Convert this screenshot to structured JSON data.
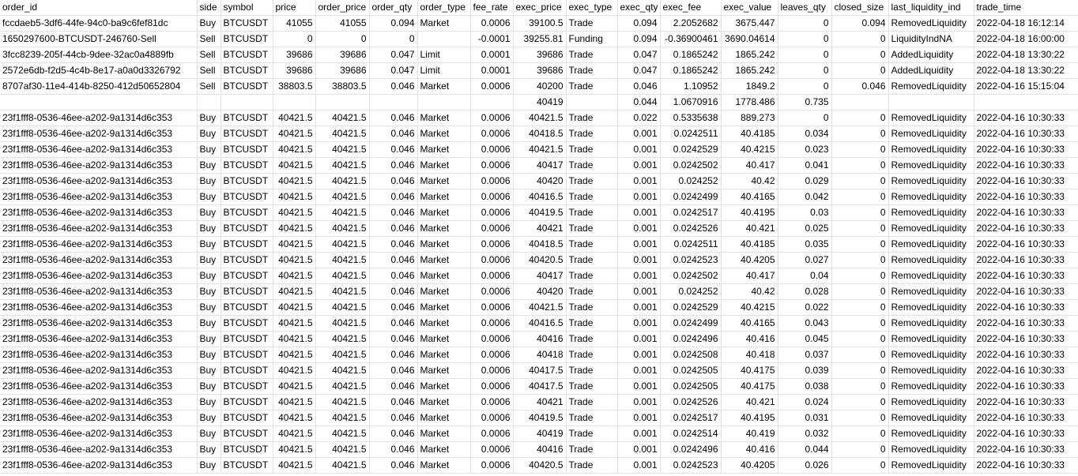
{
  "columns": [
    {
      "label": "order_id",
      "align": "left"
    },
    {
      "label": "side",
      "align": "left"
    },
    {
      "label": "symbol",
      "align": "left"
    },
    {
      "label": "price",
      "align": "right"
    },
    {
      "label": "order_price",
      "align": "right"
    },
    {
      "label": "order_qty",
      "align": "right"
    },
    {
      "label": "order_type",
      "align": "left"
    },
    {
      "label": "fee_rate",
      "align": "right"
    },
    {
      "label": "exec_price",
      "align": "right"
    },
    {
      "label": "exec_type",
      "align": "left"
    },
    {
      "label": "exec_qty",
      "align": "right"
    },
    {
      "label": "exec_fee",
      "align": "right"
    },
    {
      "label": "exec_value",
      "align": "right"
    },
    {
      "label": "leaves_qty",
      "align": "right"
    },
    {
      "label": "closed_size",
      "align": "right"
    },
    {
      "label": "last_liquidity_ind",
      "align": "left"
    },
    {
      "label": "trade_time",
      "align": "left"
    }
  ],
  "rows": [
    [
      "fccdaeb5-3df6-44fe-94c0-ba9c6fef81dc",
      "Buy",
      "BTCUSDT",
      "41055",
      "41055",
      "0.094",
      "Market",
      "0.0006",
      "39100.5",
      "Trade",
      "0.094",
      "2.2052682",
      "3675.447",
      "0",
      "0.094",
      "RemovedLiquidity",
      "2022-04-18 16:12:14"
    ],
    [
      "1650297600-BTCUSDT-246760-Sell",
      "Sell",
      "BTCUSDT",
      "0",
      "0",
      "0",
      "",
      "-0.0001",
      "39255.81",
      "Funding",
      "0.094",
      "-0.36900461",
      "3690.04614",
      "0",
      "0",
      "LiquidityIndNA",
      "2022-04-18 16:00:00"
    ],
    [
      "3fcc8239-205f-44cb-9dee-32ac0a4889fb",
      "Sell",
      "BTCUSDT",
      "39686",
      "39686",
      "0.047",
      "Limit",
      "0.0001",
      "39686",
      "Trade",
      "0.047",
      "0.1865242",
      "1865.242",
      "0",
      "0",
      "AddedLiquidity",
      "2022-04-18 13:30:22"
    ],
    [
      "2572e6db-f2d5-4c4b-8e17-a0a0d3326792",
      "Sell",
      "BTCUSDT",
      "39686",
      "39686",
      "0.047",
      "Limit",
      "0.0001",
      "39686",
      "Trade",
      "0.047",
      "0.1865242",
      "1865.242",
      "0",
      "0",
      "AddedLiquidity",
      "2022-04-18 13:30:22"
    ],
    [
      "8707af30-11e4-414b-8250-412d50652804",
      "Sell",
      "BTCUSDT",
      "38803.5",
      "38803.5",
      "0.046",
      "Market",
      "0.0006",
      "40200",
      "Trade",
      "0.046",
      "1.10952",
      "1849.2",
      "0",
      "0.046",
      "RemovedLiquidity",
      "2022-04-16 15:15:04"
    ],
    [
      "",
      "",
      "",
      "",
      "",
      "",
      "",
      "",
      "40419",
      "",
      "0.044",
      "1.0670916",
      "1778.486",
      "0.735",
      "",
      "",
      ""
    ],
    [
      "23f1fff8-0536-46ee-a202-9a1314d6c353",
      "Buy",
      "BTCUSDT",
      "40421.5",
      "40421.5",
      "0.046",
      "Market",
      "0.0006",
      "40421.5",
      "Trade",
      "0.022",
      "0.5335638",
      "889.273",
      "0",
      "0",
      "RemovedLiquidity",
      "2022-04-16 10:30:33"
    ],
    [
      "23f1fff8-0536-46ee-a202-9a1314d6c353",
      "Buy",
      "BTCUSDT",
      "40421.5",
      "40421.5",
      "0.046",
      "Market",
      "0.0006",
      "40418.5",
      "Trade",
      "0.001",
      "0.0242511",
      "40.4185",
      "0.034",
      "0",
      "RemovedLiquidity",
      "2022-04-16 10:30:33"
    ],
    [
      "23f1fff8-0536-46ee-a202-9a1314d6c353",
      "Buy",
      "BTCUSDT",
      "40421.5",
      "40421.5",
      "0.046",
      "Market",
      "0.0006",
      "40421.5",
      "Trade",
      "0.001",
      "0.0242529",
      "40.4215",
      "0.023",
      "0",
      "RemovedLiquidity",
      "2022-04-16 10:30:33"
    ],
    [
      "23f1fff8-0536-46ee-a202-9a1314d6c353",
      "Buy",
      "BTCUSDT",
      "40421.5",
      "40421.5",
      "0.046",
      "Market",
      "0.0006",
      "40417",
      "Trade",
      "0.001",
      "0.0242502",
      "40.417",
      "0.041",
      "0",
      "RemovedLiquidity",
      "2022-04-16 10:30:33"
    ],
    [
      "23f1fff8-0536-46ee-a202-9a1314d6c353",
      "Buy",
      "BTCUSDT",
      "40421.5",
      "40421.5",
      "0.046",
      "Market",
      "0.0006",
      "40420",
      "Trade",
      "0.001",
      "0.024252",
      "40.42",
      "0.029",
      "0",
      "RemovedLiquidity",
      "2022-04-16 10:30:33"
    ],
    [
      "23f1fff8-0536-46ee-a202-9a1314d6c353",
      "Buy",
      "BTCUSDT",
      "40421.5",
      "40421.5",
      "0.046",
      "Market",
      "0.0006",
      "40416.5",
      "Trade",
      "0.001",
      "0.0242499",
      "40.4165",
      "0.042",
      "0",
      "RemovedLiquidity",
      "2022-04-16 10:30:33"
    ],
    [
      "23f1fff8-0536-46ee-a202-9a1314d6c353",
      "Buy",
      "BTCUSDT",
      "40421.5",
      "40421.5",
      "0.046",
      "Market",
      "0.0006",
      "40419.5",
      "Trade",
      "0.001",
      "0.0242517",
      "40.4195",
      "0.03",
      "0",
      "RemovedLiquidity",
      "2022-04-16 10:30:33"
    ],
    [
      "23f1fff8-0536-46ee-a202-9a1314d6c353",
      "Buy",
      "BTCUSDT",
      "40421.5",
      "40421.5",
      "0.046",
      "Market",
      "0.0006",
      "40421",
      "Trade",
      "0.001",
      "0.0242526",
      "40.421",
      "0.025",
      "0",
      "RemovedLiquidity",
      "2022-04-16 10:30:33"
    ],
    [
      "23f1fff8-0536-46ee-a202-9a1314d6c353",
      "Buy",
      "BTCUSDT",
      "40421.5",
      "40421.5",
      "0.046",
      "Market",
      "0.0006",
      "40418.5",
      "Trade",
      "0.001",
      "0.0242511",
      "40.4185",
      "0.035",
      "0",
      "RemovedLiquidity",
      "2022-04-16 10:30:33"
    ],
    [
      "23f1fff8-0536-46ee-a202-9a1314d6c353",
      "Buy",
      "BTCUSDT",
      "40421.5",
      "40421.5",
      "0.046",
      "Market",
      "0.0006",
      "40420.5",
      "Trade",
      "0.001",
      "0.0242523",
      "40.4205",
      "0.027",
      "0",
      "RemovedLiquidity",
      "2022-04-16 10:30:33"
    ],
    [
      "23f1fff8-0536-46ee-a202-9a1314d6c353",
      "Buy",
      "BTCUSDT",
      "40421.5",
      "40421.5",
      "0.046",
      "Market",
      "0.0006",
      "40417",
      "Trade",
      "0.001",
      "0.0242502",
      "40.417",
      "0.04",
      "0",
      "RemovedLiquidity",
      "2022-04-16 10:30:33"
    ],
    [
      "23f1fff8-0536-46ee-a202-9a1314d6c353",
      "Buy",
      "BTCUSDT",
      "40421.5",
      "40421.5",
      "0.046",
      "Market",
      "0.0006",
      "40420",
      "Trade",
      "0.001",
      "0.024252",
      "40.42",
      "0.028",
      "0",
      "RemovedLiquidity",
      "2022-04-16 10:30:33"
    ],
    [
      "23f1fff8-0536-46ee-a202-9a1314d6c353",
      "Buy",
      "BTCUSDT",
      "40421.5",
      "40421.5",
      "0.046",
      "Market",
      "0.0006",
      "40421.5",
      "Trade",
      "0.001",
      "0.0242529",
      "40.4215",
      "0.022",
      "0",
      "RemovedLiquidity",
      "2022-04-16 10:30:33"
    ],
    [
      "23f1fff8-0536-46ee-a202-9a1314d6c353",
      "Buy",
      "BTCUSDT",
      "40421.5",
      "40421.5",
      "0.046",
      "Market",
      "0.0006",
      "40416.5",
      "Trade",
      "0.001",
      "0.0242499",
      "40.4165",
      "0.043",
      "0",
      "RemovedLiquidity",
      "2022-04-16 10:30:33"
    ],
    [
      "23f1fff8-0536-46ee-a202-9a1314d6c353",
      "Buy",
      "BTCUSDT",
      "40421.5",
      "40421.5",
      "0.046",
      "Market",
      "0.0006",
      "40416",
      "Trade",
      "0.001",
      "0.0242496",
      "40.416",
      "0.045",
      "0",
      "RemovedLiquidity",
      "2022-04-16 10:30:33"
    ],
    [
      "23f1fff8-0536-46ee-a202-9a1314d6c353",
      "Buy",
      "BTCUSDT",
      "40421.5",
      "40421.5",
      "0.046",
      "Market",
      "0.0006",
      "40418",
      "Trade",
      "0.001",
      "0.0242508",
      "40.418",
      "0.037",
      "0",
      "RemovedLiquidity",
      "2022-04-16 10:30:33"
    ],
    [
      "23f1fff8-0536-46ee-a202-9a1314d6c353",
      "Buy",
      "BTCUSDT",
      "40421.5",
      "40421.5",
      "0.046",
      "Market",
      "0.0006",
      "40417.5",
      "Trade",
      "0.001",
      "0.0242505",
      "40.4175",
      "0.039",
      "0",
      "RemovedLiquidity",
      "2022-04-16 10:30:33"
    ],
    [
      "23f1fff8-0536-46ee-a202-9a1314d6c353",
      "Buy",
      "BTCUSDT",
      "40421.5",
      "40421.5",
      "0.046",
      "Market",
      "0.0006",
      "40417.5",
      "Trade",
      "0.001",
      "0.0242505",
      "40.4175",
      "0.038",
      "0",
      "RemovedLiquidity",
      "2022-04-16 10:30:33"
    ],
    [
      "23f1fff8-0536-46ee-a202-9a1314d6c353",
      "Buy",
      "BTCUSDT",
      "40421.5",
      "40421.5",
      "0.046",
      "Market",
      "0.0006",
      "40421",
      "Trade",
      "0.001",
      "0.0242526",
      "40.421",
      "0.024",
      "0",
      "RemovedLiquidity",
      "2022-04-16 10:30:33"
    ],
    [
      "23f1fff8-0536-46ee-a202-9a1314d6c353",
      "Buy",
      "BTCUSDT",
      "40421.5",
      "40421.5",
      "0.046",
      "Market",
      "0.0006",
      "40419.5",
      "Trade",
      "0.001",
      "0.0242517",
      "40.4195",
      "0.031",
      "0",
      "RemovedLiquidity",
      "2022-04-16 10:30:33"
    ],
    [
      "23f1fff8-0536-46ee-a202-9a1314d6c353",
      "Buy",
      "BTCUSDT",
      "40421.5",
      "40421.5",
      "0.046",
      "Market",
      "0.0006",
      "40419",
      "Trade",
      "0.001",
      "0.0242514",
      "40.419",
      "0.032",
      "0",
      "RemovedLiquidity",
      "2022-04-16 10:30:33"
    ],
    [
      "23f1fff8-0536-46ee-a202-9a1314d6c353",
      "Buy",
      "BTCUSDT",
      "40421.5",
      "40421.5",
      "0.046",
      "Market",
      "0.0006",
      "40416",
      "Trade",
      "0.001",
      "0.0242496",
      "40.416",
      "0.044",
      "0",
      "RemovedLiquidity",
      "2022-04-16 10:30:33"
    ],
    [
      "23f1fff8-0536-46ee-a202-9a1314d6c353",
      "Buy",
      "BTCUSDT",
      "40421.5",
      "40421.5",
      "0.046",
      "Market",
      "0.0006",
      "40420.5",
      "Trade",
      "0.001",
      "0.0242523",
      "40.4205",
      "0.026",
      "0",
      "RemovedLiquidity",
      "2022-04-16 10:30:33"
    ]
  ]
}
